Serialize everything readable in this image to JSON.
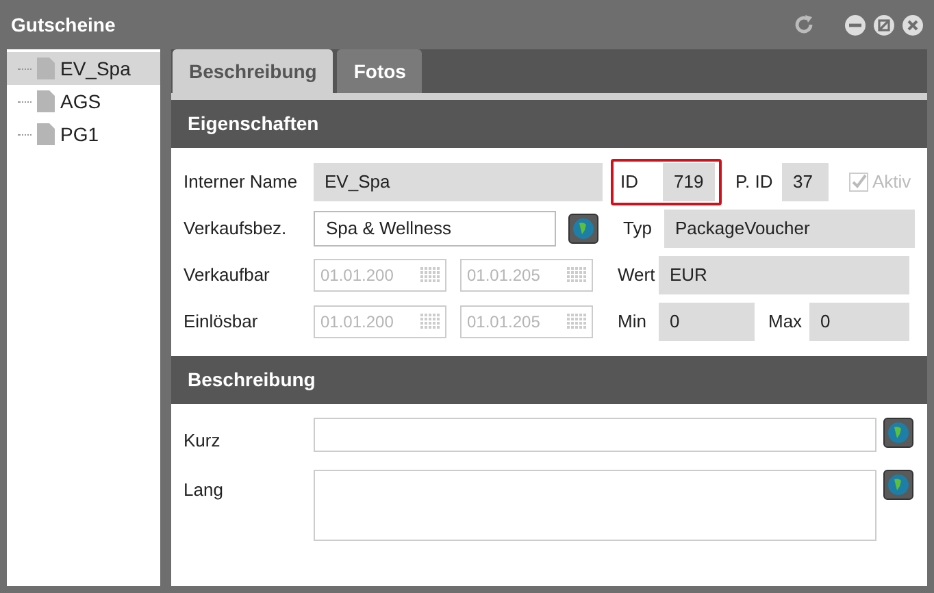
{
  "window": {
    "title": "Gutscheine"
  },
  "tree": [
    {
      "label": "EV_Spa",
      "selected": true
    },
    {
      "label": "AGS",
      "selected": false
    },
    {
      "label": "PG1",
      "selected": false
    }
  ],
  "tabs": [
    {
      "label": "Beschreibung",
      "selected": true
    },
    {
      "label": "Fotos",
      "selected": false
    }
  ],
  "properties": {
    "title": "Eigenschaften",
    "internal_name": {
      "label": "Interner Name",
      "value": "EV_Spa"
    },
    "id": {
      "label": "ID",
      "value": "719",
      "highlighted": true
    },
    "parent_id": {
      "label": "P. ID",
      "value": "37"
    },
    "active": {
      "label": "Aktiv",
      "checked": true,
      "disabled": true
    },
    "sales_name": {
      "label": "Verkaufsbez.",
      "value": "Spa & Wellness"
    },
    "type": {
      "label": "Typ",
      "value": "PackageVoucher"
    },
    "sellable": {
      "label": "Verkaufbar",
      "from": "01.01.200",
      "to": "01.01.205"
    },
    "value": {
      "label": "Wert",
      "value": "EUR"
    },
    "redeemable": {
      "label": "Einlösbar",
      "from": "01.01.200",
      "to": "01.01.205"
    },
    "min": {
      "label": "Min",
      "value": "0"
    },
    "max": {
      "label": "Max",
      "value": "0"
    }
  },
  "description": {
    "title": "Beschreibung",
    "short": {
      "label": "Kurz"
    },
    "long": {
      "label": "Lang"
    }
  }
}
